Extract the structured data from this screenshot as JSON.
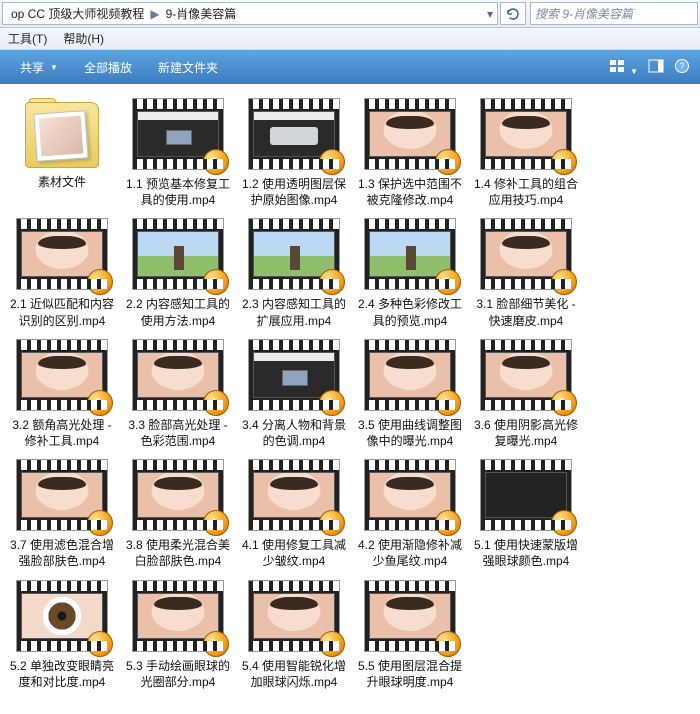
{
  "address": {
    "seg1": "op CC 顶级大师视频教程",
    "seg2": "9-肖像美容篇"
  },
  "search": {
    "placeholder": "搜索 9-肖像美容篇"
  },
  "menu": {
    "tools": "工具(T)",
    "help": "帮助(H)"
  },
  "toolbar": {
    "share": "共享",
    "playall": "全部播放",
    "newfolder": "新建文件夹"
  },
  "items": [
    {
      "type": "folder",
      "label": "素材文件"
    },
    {
      "type": "video",
      "label": "1.1 预览基本修复工具的使用.mp4",
      "ph": "ph-ui"
    },
    {
      "type": "video",
      "label": "1.2 使用透明图层保护原始图像.mp4",
      "ph": "ph-ui2"
    },
    {
      "type": "video",
      "label": "1.3 保护选中范围不被克隆修改.mp4",
      "ph": "ph-face"
    },
    {
      "type": "video",
      "label": "1.4 修补工具的组合应用技巧.mp4",
      "ph": "ph-face"
    },
    {
      "type": "video",
      "label": "2.1 近似匹配和内容识别的区别.mp4",
      "ph": "ph-face"
    },
    {
      "type": "video",
      "label": "2.2 内容感知工具的使用方法.mp4",
      "ph": "ph-land"
    },
    {
      "type": "video",
      "label": "2.3 内容感知工具的扩展应用.mp4",
      "ph": "ph-land"
    },
    {
      "type": "video",
      "label": "2.4 多种色彩修改工具的预览.mp4",
      "ph": "ph-land"
    },
    {
      "type": "video",
      "label": "3.1 脸部细节美化 - 快速磨皮.mp4",
      "ph": "ph-face"
    },
    {
      "type": "video",
      "label": "3.2 额角高光处理 - 修补工具.mp4",
      "ph": "ph-face"
    },
    {
      "type": "video",
      "label": "3.3 脸部高光处理 - 色彩范围.mp4",
      "ph": "ph-face"
    },
    {
      "type": "video",
      "label": "3.4 分离人物和背景的色调.mp4",
      "ph": "ph-ui"
    },
    {
      "type": "video",
      "label": "3.5 使用曲线调整图像中的曝光.mp4",
      "ph": "ph-face"
    },
    {
      "type": "video",
      "label": "3.6 使用阴影高光修复曝光.mp4",
      "ph": "ph-face"
    },
    {
      "type": "video",
      "label": "3.7 使用滤色混合增强脸部肤色.mp4",
      "ph": "ph-face"
    },
    {
      "type": "video",
      "label": "3.8 使用柔光混合美白脸部肤色.mp4",
      "ph": "ph-face"
    },
    {
      "type": "video",
      "label": "4.1 使用修复工具减少皱纹.mp4",
      "ph": "ph-face"
    },
    {
      "type": "video",
      "label": "4.2 使用渐隐修补减少鱼尾纹.mp4",
      "ph": "ph-face"
    },
    {
      "type": "video",
      "label": "5.1 使用快速蒙版增强眼球颜色.mp4",
      "ph": "ph-dark"
    },
    {
      "type": "video",
      "label": "5.2 单独改变眼睛亮度和对比度.mp4",
      "ph": "ph-eye"
    },
    {
      "type": "video",
      "label": "5.3 手动绘画眼球的光圈部分.mp4",
      "ph": "ph-face"
    },
    {
      "type": "video",
      "label": "5.4 使用智能锐化增加眼球闪烁.mp4",
      "ph": "ph-face"
    },
    {
      "type": "video",
      "label": "5.5 使用图层混合提升眼球明度.mp4",
      "ph": "ph-face"
    }
  ]
}
